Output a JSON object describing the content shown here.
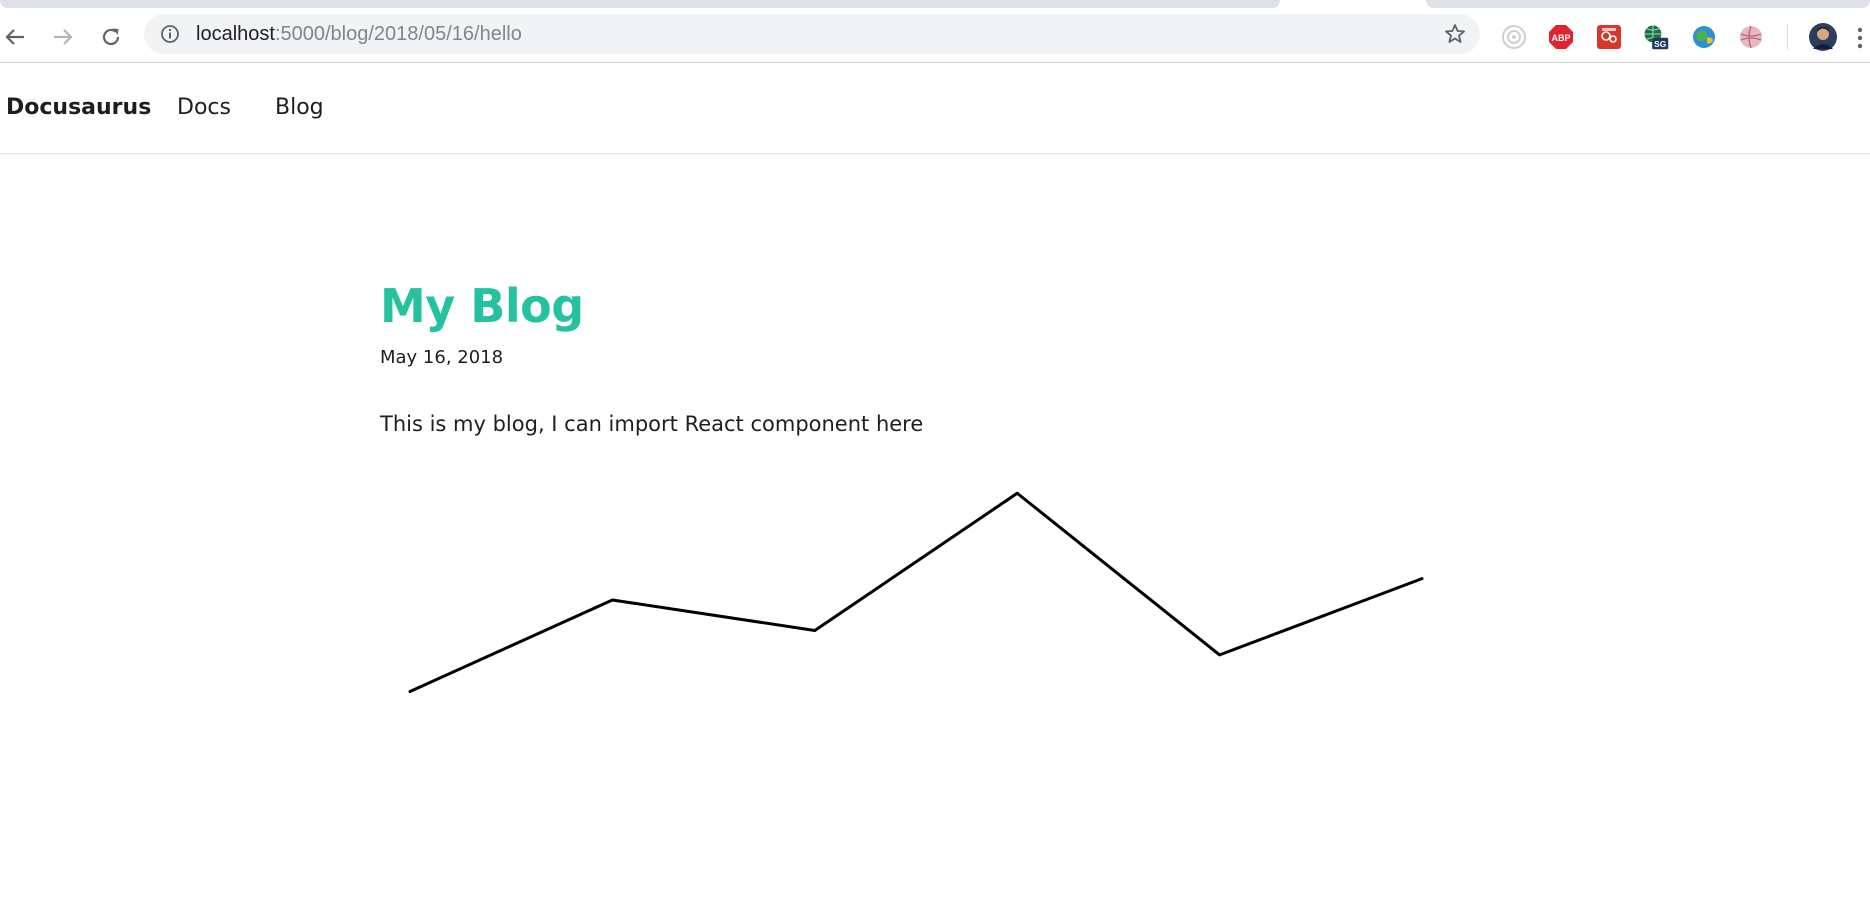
{
  "browser": {
    "url_host": "localhost",
    "url_rest": ":5000/blog/2018/05/16/hello",
    "icons": {
      "back": "back-arrow-icon",
      "forward": "forward-arrow-icon",
      "reload": "reload-icon",
      "info": "info-icon",
      "bookmark": "star-icon"
    },
    "extensions": [
      {
        "name": "target-extension-icon"
      },
      {
        "name": "adblock-plus-extension-icon",
        "text": "ABP"
      },
      {
        "name": "red-extension-icon"
      },
      {
        "name": "globe-sg-extension-icon",
        "badge": "SG"
      },
      {
        "name": "green-globe-extension-icon"
      },
      {
        "name": "pink-ball-extension-icon"
      },
      {
        "name": "profile-avatar"
      }
    ]
  },
  "site": {
    "brand": "Docusaurus",
    "nav": [
      "Docs",
      "Blog"
    ]
  },
  "post": {
    "title": "My Blog",
    "date": "May 16, 2018",
    "body": "This is my blog, I can import React component here"
  },
  "colors": {
    "accent": "#25c2a0",
    "text": "#1c1e21",
    "line": "#000000"
  },
  "chart_data": {
    "type": "line",
    "x": [
      0,
      1,
      2,
      3,
      4,
      5
    ],
    "values": [
      10,
      40,
      30,
      75,
      22,
      47
    ],
    "ylim": [
      0,
      80
    ],
    "axes": false,
    "grid": false
  }
}
